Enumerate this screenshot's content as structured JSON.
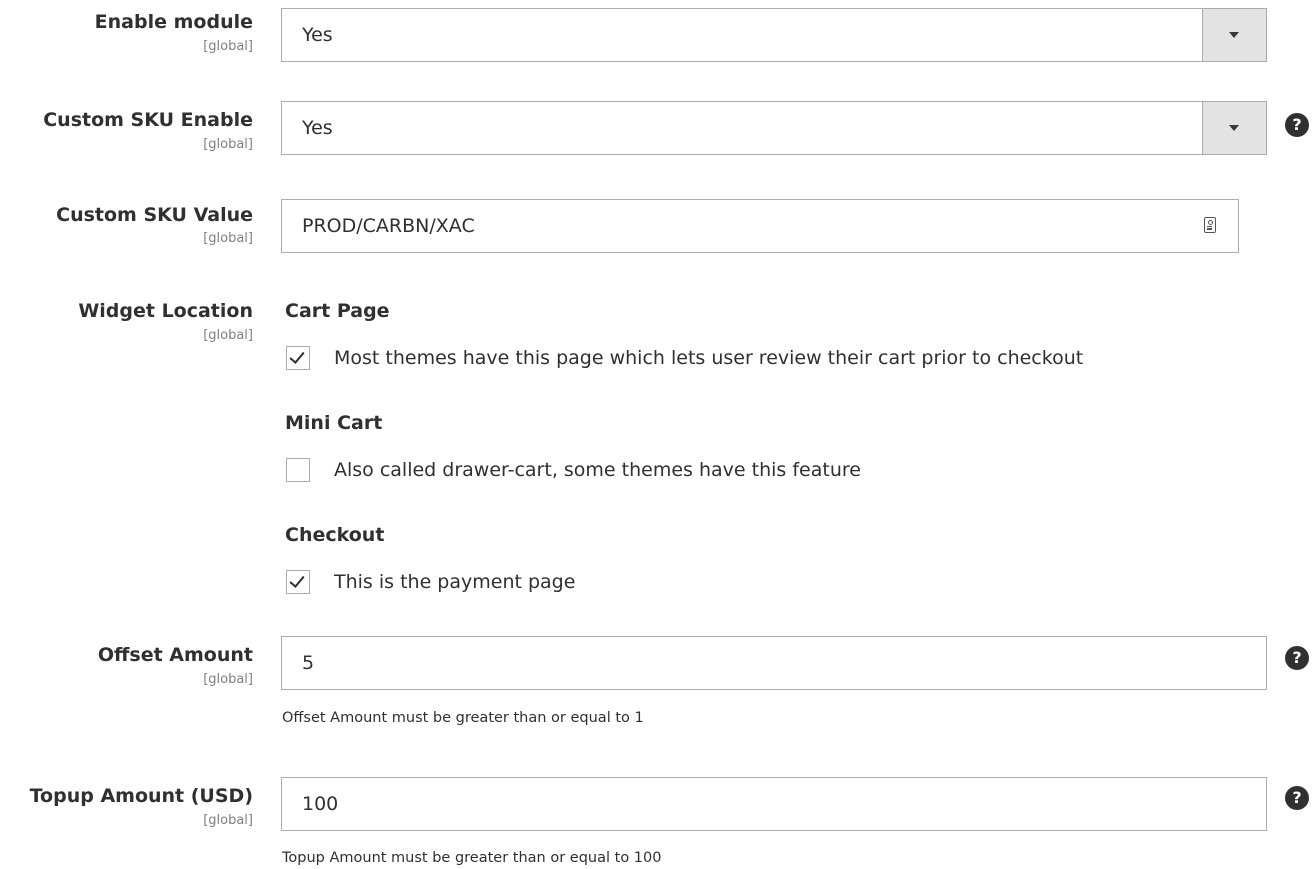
{
  "fields": {
    "enable_module": {
      "label": "Enable module",
      "scope": "[global]",
      "value": "Yes"
    },
    "custom_sku_enable": {
      "label": "Custom SKU Enable",
      "scope": "[global]",
      "value": "Yes",
      "help": "?"
    },
    "custom_sku_value": {
      "label": "Custom SKU Value",
      "scope": "[global]",
      "value": "PROD/CARBN/XAC"
    },
    "widget_location": {
      "label": "Widget Location",
      "scope": "[global]",
      "options": [
        {
          "title": "Cart Page",
          "description": "Most themes have this page which lets user review their cart prior to checkout",
          "checked": true
        },
        {
          "title": "Mini Cart",
          "description": "Also called drawer-cart, some themes have this feature",
          "checked": false
        },
        {
          "title": "Checkout",
          "description": "This is the payment page",
          "checked": true
        }
      ]
    },
    "offset_amount": {
      "label": "Offset Amount",
      "scope": "[global]",
      "value": "5",
      "help": "?",
      "note": "Offset Amount must be greater than or equal to 1"
    },
    "topup_amount": {
      "label": "Topup Amount (USD)",
      "scope": "[global]",
      "value": "100",
      "help": "?",
      "note": "Topup Amount must be greater than or equal to 100"
    }
  }
}
